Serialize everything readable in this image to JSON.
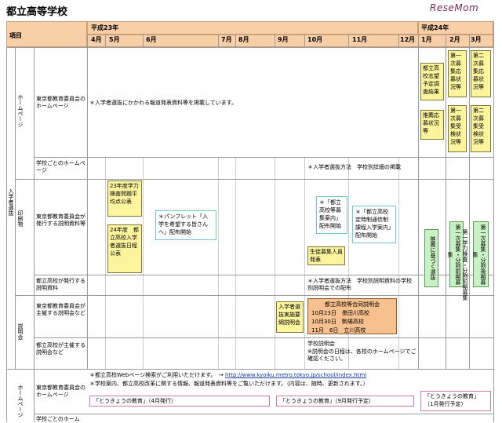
{
  "title": "都立高等学校",
  "logo": {
    "brand1": "Rese",
    "brand2": "Mom"
  },
  "header": {
    "item_label": "項目",
    "year1": "平成23年",
    "year2": "平成24年",
    "months": [
      "4月",
      "5月",
      "6月",
      "7月",
      "8月",
      "9月",
      "10月",
      "11月",
      "12月",
      "1月",
      "2月",
      "3月"
    ]
  },
  "categories": {
    "main": "入学者選抜",
    "homepage": "ホームページ",
    "print": "印刷物",
    "info": "説明会",
    "homepage2": "ホームページ"
  },
  "rows": {
    "board_hp": "東京都教育委員会のホームページ",
    "school_hp": "学校ごとのホームページ",
    "board_print": "東京都教育委員会が発行する説明資料等",
    "school_print": "都立高校が発行する説明資料",
    "board_info": "東京都教育委員会が主催する説明会など",
    "school_info": "都立高校が主催する説明会など",
    "board_hp2": "東京都教育委員会のホームページ",
    "school_hp2": "学校ごとのホーム"
  },
  "notes": {
    "board_hp": "＊入学者選抜にかかわる報道発表資料等を掲載しています。",
    "school_hp": "＊入学者選抜方法　学校別詳細の掲載",
    "school_print": "＊入学者選抜方法　学校別説明資料の学校別説明会での配布",
    "school_info1": "学校説明会",
    "school_info2": "※説明会の日程は、各校のホームページでご確認ください。",
    "web_note": "＊都立高校Webページ検索がご利用いただけます。　→",
    "web_url": "http://www.kyoiku.metro.tokyo.jp/school/index.html",
    "press_note": "＊学校案内、都立高校改革に関する情報、報道発表資料等をご覧いただけます。（内容は、随時、更新されます。）"
  },
  "boxes": {
    "shibo": "都立高校志望予定調査結果",
    "first_boshu": "第一次募集応募状況等",
    "second_boshu": "第二次募集応募状況等",
    "suisen": "推薦応募状況等",
    "first_jukken": "第一次募集受検状況等",
    "second_jukken": "第二次募集受検状況等",
    "gakuryoku": "23年度学力検査問題平均点公表",
    "nittei": "24年度　都立高校入学者選抜日程公表",
    "pamphlet": "＊パンフレット「入学を希望する皆さんへ」配布開始",
    "boshu_annai": "＊「都立高校等募集案内」配布開始",
    "teijisei": "＊「都立高校定時制通信制課程入学案内」配布開始",
    "seito_boshu": "生徒募集人員発表",
    "senbatsu_setsumei": "入学者選抜実施要綱説明会",
    "gohappyo_title": "都立高校等合同説明会",
    "godo1": "10月23日　墨田川高校",
    "godo2": "10月30日　駒場高校",
    "godo3": "11月　6日　立川高校",
    "suisen_kizuku": "推薦に基づく選抜",
    "first_bunkatsu_zen": "第一次募集・分割前期募集",
    "first_bunkatsu_go": "第一次募集・分割後期募集",
    "first_kekka": "第一学力検査・分割前期募集",
    "kyoiku1": "「とうきょうの教育」（4月発行）",
    "kyoiku2": "「とうきょうの教育」（9月発行予定）",
    "kyoiku3": "「とうきょうの教育」",
    "kyoiku3b": "（1月発行予定）"
  }
}
